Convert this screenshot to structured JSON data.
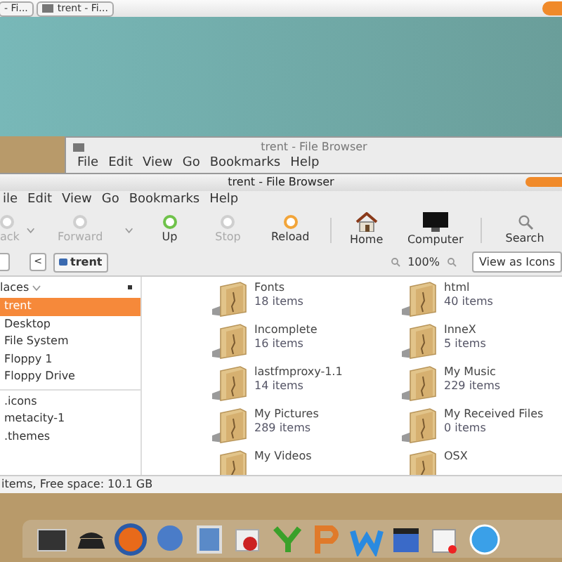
{
  "taskbar": {
    "buttons": [
      {
        "label": "- Fi..."
      },
      {
        "label": "trent - Fi..."
      }
    ]
  },
  "back_window": {
    "title": "trent - File Browser",
    "menu": [
      "File",
      "Edit",
      "View",
      "Go",
      "Bookmarks",
      "Help"
    ]
  },
  "window": {
    "title": "trent - File Browser",
    "menu": [
      "ile",
      "Edit",
      "View",
      "Go",
      "Bookmarks",
      "Help"
    ],
    "toolbar": [
      {
        "label": "ack",
        "kind": "back",
        "disabled": true
      },
      {
        "label": "Forward",
        "kind": "forward",
        "disabled": true
      },
      {
        "label": "Up",
        "kind": "up",
        "disabled": false
      },
      {
        "label": "Stop",
        "kind": "stop",
        "disabled": true
      },
      {
        "label": "Reload",
        "kind": "reload",
        "disabled": false
      },
      {
        "label": "Home",
        "kind": "home",
        "disabled": false
      },
      {
        "label": "Computer",
        "kind": "computer",
        "disabled": false
      },
      {
        "label": "Search",
        "kind": "search",
        "disabled": false
      }
    ],
    "path_back": "<",
    "path": "trent",
    "zoom": "100%",
    "view_mode": "View as Icons",
    "sidebar": {
      "header": "laces",
      "places": [
        {
          "label": "trent",
          "selected": true
        },
        {
          "label": "Desktop",
          "selected": false
        },
        {
          "label": "File System",
          "selected": false
        },
        {
          "label": "Floppy 1",
          "selected": false
        },
        {
          "label": "Floppy Drive",
          "selected": false
        }
      ],
      "bookmarks": [
        ".icons",
        "metacity-1",
        ".themes"
      ]
    },
    "files": [
      {
        "name": "Fonts",
        "count": "18 items"
      },
      {
        "name": "html",
        "count": "40 items"
      },
      {
        "name": "Incomplete",
        "count": "16 items"
      },
      {
        "name": "InneX",
        "count": "5 items"
      },
      {
        "name": "lastfmproxy-1.1",
        "count": "14 items"
      },
      {
        "name": "My Music",
        "count": "229 items"
      },
      {
        "name": "My Pictures",
        "count": "289 items"
      },
      {
        "name": "My Received Files",
        "count": "0 items"
      },
      {
        "name": "My Videos"
      },
      {
        "name": "OSX"
      }
    ],
    "status": "items, Free space: 10.1 GB"
  }
}
